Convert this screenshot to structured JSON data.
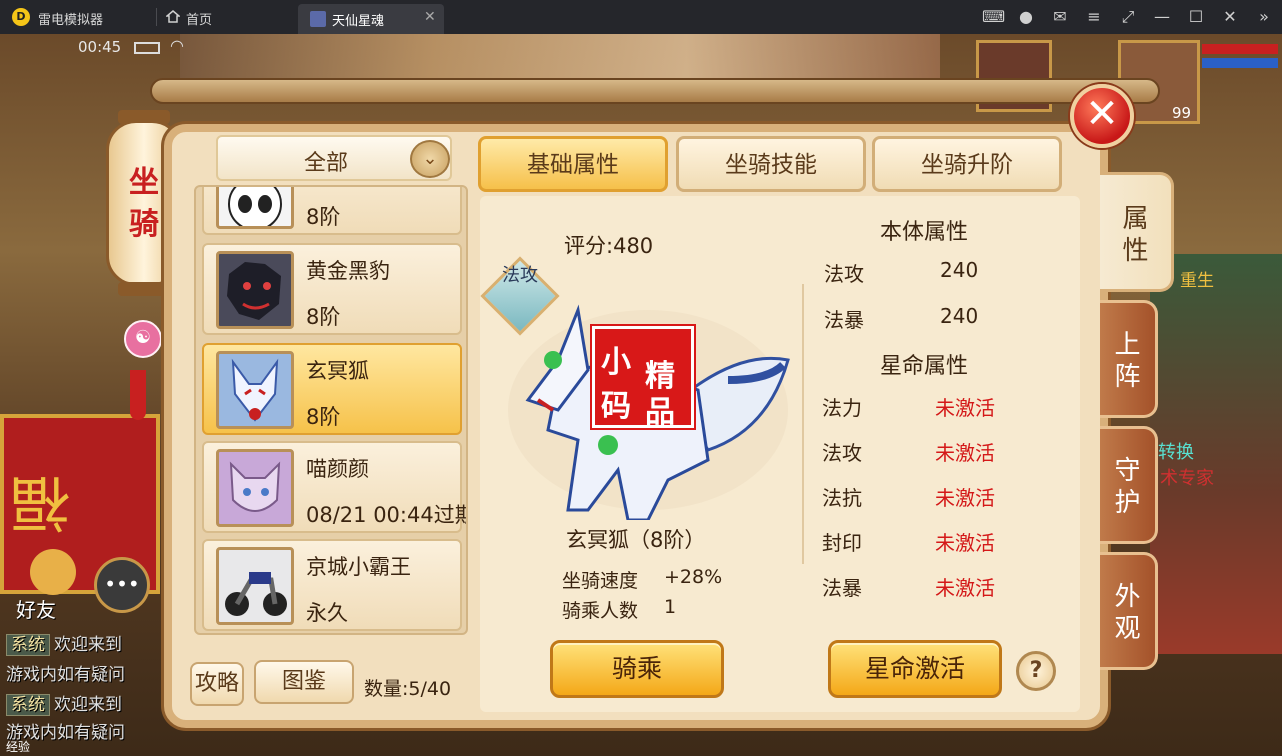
{
  "emulator": {
    "app_name": "雷电模拟器",
    "home_label": "首页",
    "tab_label": "天仙星魂",
    "tab_close": "✕",
    "controls": [
      "gamepad-icon",
      "account-icon",
      "mail-icon",
      "menu-icon",
      "resize-icon",
      "minimize-icon",
      "maximize-icon",
      "close-icon",
      "collapse-icon"
    ]
  },
  "status": {
    "time": "00:45"
  },
  "scene": {
    "fu_char": "福",
    "right_text_1": "转换",
    "right_text_2": "术专家",
    "right_text_3": "重生",
    "friend_label": "好友",
    "chat": [
      {
        "tag": "系统",
        "text": "欢迎来到"
      },
      {
        "tag": "",
        "text": "游戏内如有疑问"
      },
      {
        "tag": "系统",
        "text": "欢迎来到"
      },
      {
        "tag": "",
        "text": "游戏内如有疑问"
      }
    ],
    "exp_label": "经验",
    "player_level": "99"
  },
  "lantern": {
    "title_line1": "坐",
    "title_line2": "骑"
  },
  "panel": {
    "filter": {
      "selected": "全部"
    },
    "mounts": [
      {
        "name": "",
        "sub": "8阶",
        "thumb": "panda"
      },
      {
        "name": "黄金黑豹",
        "sub": "8阶",
        "thumb": "black-panther"
      },
      {
        "name": "玄冥狐",
        "sub": "8阶",
        "thumb": "fox",
        "selected": true
      },
      {
        "name": "喵颜颜",
        "sub": "08/21 00:44过期",
        "thumb": "cat"
      },
      {
        "name": "京城小霸王",
        "sub": "永久",
        "thumb": "motorbike"
      }
    ],
    "guide_button": "攻略",
    "atlas_button": "图鉴",
    "count_label": "数量:",
    "count_value": "5/40",
    "tabs": [
      "基础属性",
      "坐骑技能",
      "坐骑升阶"
    ],
    "active_tab": 0,
    "side_tabs": [
      {
        "label": "属性",
        "active": true
      },
      {
        "label": "上阵"
      },
      {
        "label": "守护"
      },
      {
        "label": "外观"
      }
    ],
    "detail": {
      "score_label": "评分:",
      "score": "480",
      "type_badge": "法攻",
      "stamp_chars": [
        "小",
        "精",
        "码",
        "品"
      ],
      "mount_name": "玄冥狐（8阶）",
      "speed_label": "坐骑速度",
      "speed_value": "+28%",
      "riders_label": "骑乘人数",
      "riders_value": "1",
      "base_title": "本体属性",
      "base_attrs": [
        {
          "name": "法攻",
          "value": "240"
        },
        {
          "name": "法暴",
          "value": "240"
        }
      ],
      "star_title": "星命属性",
      "star_attrs": [
        {
          "name": "法力",
          "value": "未激活"
        },
        {
          "name": "法攻",
          "value": "未激活"
        },
        {
          "name": "法抗",
          "value": "未激活"
        },
        {
          "name": "封印",
          "value": "未激活"
        },
        {
          "name": "法暴",
          "value": "未激活"
        }
      ],
      "ride_button": "骑乘",
      "activate_button": "星命激活",
      "help_button": "?"
    },
    "close_button": "✕"
  },
  "colors": {
    "accent": "#f6c04a",
    "inactive_red": "#d41818",
    "panel_bg": "#f2dfbe"
  }
}
